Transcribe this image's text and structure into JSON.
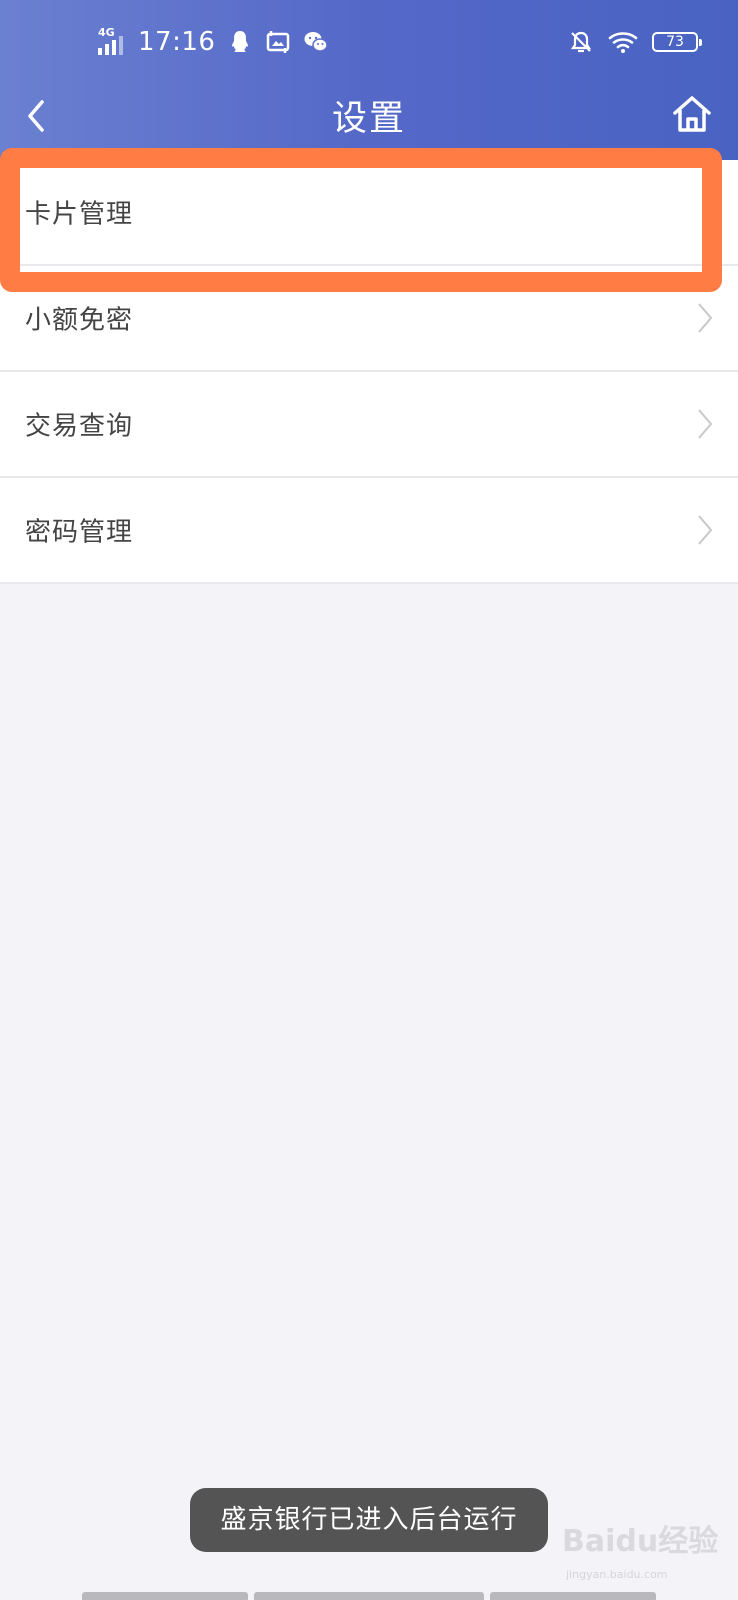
{
  "status_bar": {
    "network_type": "4G",
    "time": "17:16",
    "battery_level": "73",
    "icons": [
      "qq-icon",
      "photo-icon",
      "wechat-icon",
      "bell-muted-icon",
      "wifi-icon",
      "battery-icon"
    ]
  },
  "nav": {
    "title": "设置",
    "back_icon": "chevron-left-icon",
    "home_icon": "home-icon"
  },
  "menu": {
    "items": [
      {
        "label": "卡片管理"
      },
      {
        "label": "小额免密"
      },
      {
        "label": "交易查询"
      },
      {
        "label": "密码管理"
      }
    ]
  },
  "toast": {
    "text": "盛京银行已进入后台运行"
  },
  "watermark": {
    "text": "Baidu经验",
    "url": "jingyan.baidu.com"
  },
  "colors": {
    "header_gradient_start": "#6a80d0",
    "header_gradient_end": "#4963c2",
    "highlight": "#ff7d45",
    "page_background": "#f4f3f7"
  }
}
